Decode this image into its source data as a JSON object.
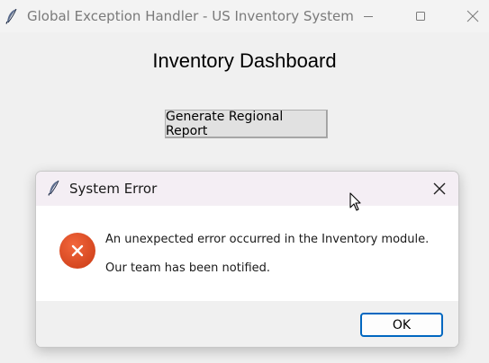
{
  "window": {
    "title": "Global Exception Handler - US Inventory System",
    "icon": "feather-icon",
    "controls": [
      "minimize-icon",
      "maximize-icon",
      "close-icon"
    ]
  },
  "main": {
    "heading": "Inventory Dashboard",
    "report_button_label": "Generate Regional Report"
  },
  "dialog": {
    "title": "System Error",
    "icon": "feather-icon",
    "status_icon": "error-x-icon",
    "message_line1": "An unexpected error occurred in the Inventory module.",
    "message_line2": "Our team has been notified.",
    "ok_label": "OK"
  },
  "colors": {
    "error_red": "#d9431c",
    "focus_blue": "#0067c0",
    "dialog_title_bg": "#f4eef4"
  }
}
